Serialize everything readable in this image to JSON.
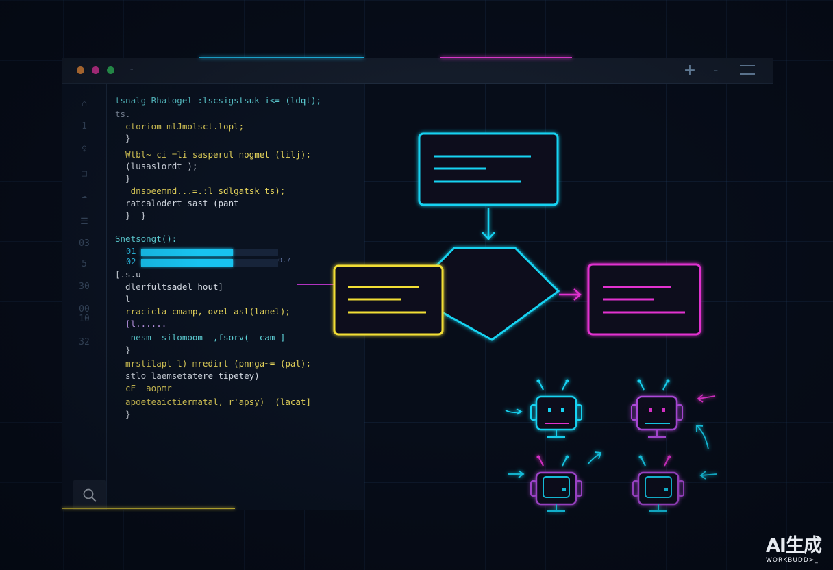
{
  "window": {
    "title_dash": "-",
    "buttons": {
      "plus": "+",
      "minus": "-"
    },
    "traffic_lights": [
      "#e48a3c",
      "#d8359a",
      "#2fb35a"
    ]
  },
  "gutter": {
    "items": [
      "⌂",
      "1",
      "♀",
      "□",
      "☁",
      "☰",
      "03",
      "5",
      "30",
      "00",
      "10",
      "32",
      "–"
    ]
  },
  "editor": {
    "lines": [
      "tsnalg Rhatogel :lscsigstsuk i<= (ldqt);",
      "ts.",
      "  ctoriom mlJmolsct.lopl;",
      "  }",
      "  Wtbl~ ci =li sasperul nogmet (lilj);",
      "  (lusaslordt );",
      "  }",
      "   dnsoeemnd...=.:l sdlgatsk ts);",
      "  ratcalodert sast_(pant",
      "  }  }",
      "Snetsongt():",
      "[.s.u",
      "  dlerfultsadel hout]",
      "  l",
      "  rracicla cmamp, ovel asl(lanel);",
      "  [l......",
      "   nesm  silomoom  ,fsorv(  cam ]",
      "  }",
      "  mrstilapt l) mredirt (pnnga~= (pal);",
      "  stlo laemsetatere tipetey)",
      "  cE  aopmr",
      "  apoeteaictiermatal, r'apsy)  (lacat]",
      "  }"
    ],
    "progress_rows": [
      {
        "label": "01",
        "value": 0.67
      },
      {
        "label": "02",
        "value": 0.67
      }
    ],
    "progress_side_text": "0.7"
  },
  "diagram": {
    "colors": {
      "cyan": "#19d3f2",
      "yellow": "#f2de35",
      "pink": "#e232d0",
      "purple": "#b24ce0"
    }
  },
  "watermark": {
    "main": "AI生成",
    "sub": "WORKBUDD>_"
  }
}
